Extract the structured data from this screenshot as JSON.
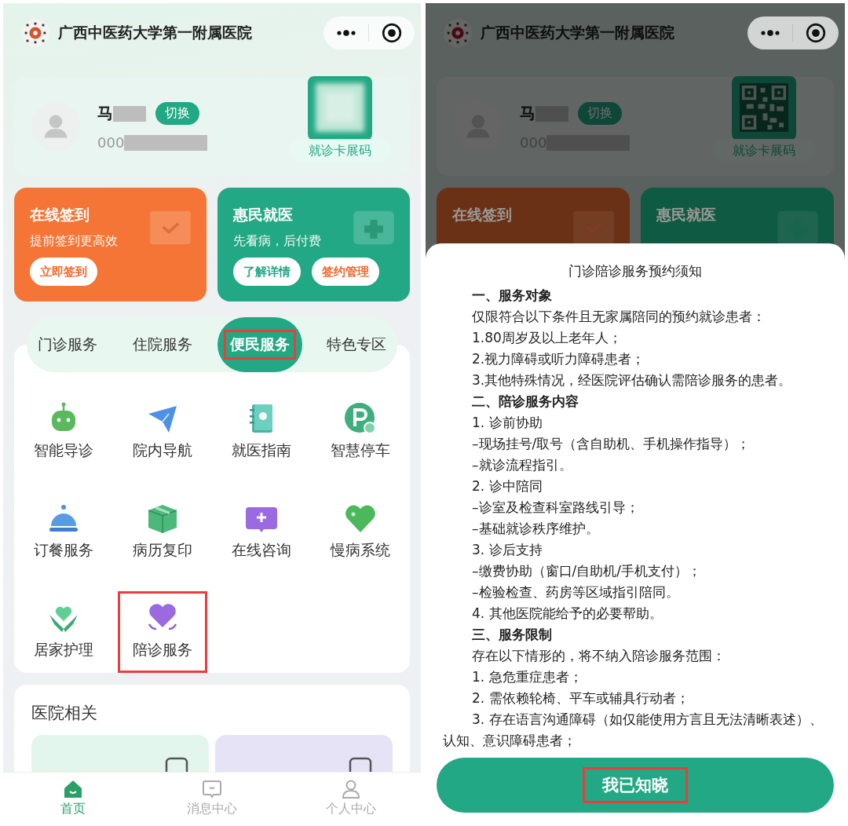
{
  "home": {
    "header": {
      "title": "广西中医药大学第一附属医院"
    },
    "profile": {
      "name_prefix": "马",
      "switch_label": "切换",
      "id_prefix": "000",
      "card_code_label": "就诊卡展码",
      "qr_blurred": true
    },
    "quick_cards": [
      {
        "title": "在线签到",
        "subtitle": "提前签到更高效",
        "color": "#f47535",
        "buttons": [
          "立即签到"
        ]
      },
      {
        "title": "惠民就医",
        "subtitle": "先看病，后付费",
        "color": "#22a884",
        "buttons": [
          "了解详情",
          "签约管理"
        ]
      }
    ],
    "service_tabs": [
      {
        "label": "门诊服务",
        "selected": false,
        "highlighted": false
      },
      {
        "label": "住院服务",
        "selected": false,
        "highlighted": false
      },
      {
        "label": "便民服务",
        "selected": true,
        "highlighted": true
      },
      {
        "label": "特色专区",
        "selected": false,
        "highlighted": false
      }
    ],
    "services": [
      {
        "label": "智能导诊",
        "highlighted": false
      },
      {
        "label": "院内导航",
        "highlighted": false
      },
      {
        "label": "就医指南",
        "highlighted": false
      },
      {
        "label": "智慧停车",
        "highlighted": false
      },
      {
        "label": "订餐服务",
        "highlighted": false
      },
      {
        "label": "病历复印",
        "highlighted": false
      },
      {
        "label": "在线咨询",
        "highlighted": false
      },
      {
        "label": "慢病系统",
        "highlighted": false
      },
      {
        "label": "居家护理",
        "highlighted": false
      },
      {
        "label": "陪诊服务",
        "highlighted": true
      }
    ],
    "related": {
      "title": "医院相关",
      "items": [
        {
          "color": "#e3f6ee"
        },
        {
          "color": "#e6e3f6"
        }
      ]
    },
    "bottom_nav": [
      {
        "label": "首页",
        "selected": true
      },
      {
        "label": "消息中心",
        "selected": false
      },
      {
        "label": "个人中心",
        "selected": false
      }
    ]
  },
  "notice_view": {
    "header": {
      "title": "广西中医药大学第一附属医院"
    },
    "profile": {
      "name_prefix": "马",
      "switch_label": "切换",
      "id_prefix": "000",
      "card_code_label": "就诊卡展码",
      "qr_blurred": false
    },
    "quick_cards": [
      {
        "title": "在线签到",
        "color": "#6b3117"
      },
      {
        "title": "惠民就医",
        "color": "#0f5a43"
      }
    ],
    "notice": {
      "title": "门诊陪诊服务预约须知",
      "lines": [
        {
          "kind": "heading",
          "text": "一、服务对象"
        },
        {
          "kind": "text",
          "text": "仅限符合以下条件且无家属陪同的预约就诊患者："
        },
        {
          "kind": "text",
          "text": "1.80周岁及以上老年人；"
        },
        {
          "kind": "text",
          "text": "2.视力障碍或听力障碍患者；"
        },
        {
          "kind": "text",
          "text": "3.其他特殊情况，经医院评估确认需陪诊服务的患者。"
        },
        {
          "kind": "heading",
          "text": "二、陪诊服务内容"
        },
        {
          "kind": "text",
          "text": "1. 诊前协助"
        },
        {
          "kind": "text",
          "text": "–现场挂号/取号（含自助机、手机操作指导）；"
        },
        {
          "kind": "text",
          "text": "–就诊流程指引。"
        },
        {
          "kind": "text",
          "text": "2. 诊中陪同"
        },
        {
          "kind": "text",
          "text": "–诊室及检查科室路线引导；"
        },
        {
          "kind": "text",
          "text": "–基础就诊秩序维护。"
        },
        {
          "kind": "text",
          "text": "3. 诊后支持"
        },
        {
          "kind": "text",
          "text": "–缴费协助（窗口/自助机/手机支付）；"
        },
        {
          "kind": "text",
          "text": "–检验检查、药房等区域指引陪同。"
        },
        {
          "kind": "text",
          "text": "4. 其他医院能给予的必要帮助。"
        },
        {
          "kind": "heading",
          "text": "三、服务限制"
        },
        {
          "kind": "text",
          "text": "存在以下情形的，将不纳入陪诊服务范围："
        },
        {
          "kind": "text",
          "text": "1. 急危重症患者；"
        },
        {
          "kind": "text",
          "text": "2. 需依赖轮椅、平车或辅具行动者；"
        },
        {
          "kind": "text",
          "text": "3. 存在语言沟通障碍（如仅能使用方言且无法清晰表述）、认知、意识障碍患者；"
        }
      ]
    },
    "confirm_button": {
      "label": "我已知晓",
      "highlighted": true
    }
  }
}
